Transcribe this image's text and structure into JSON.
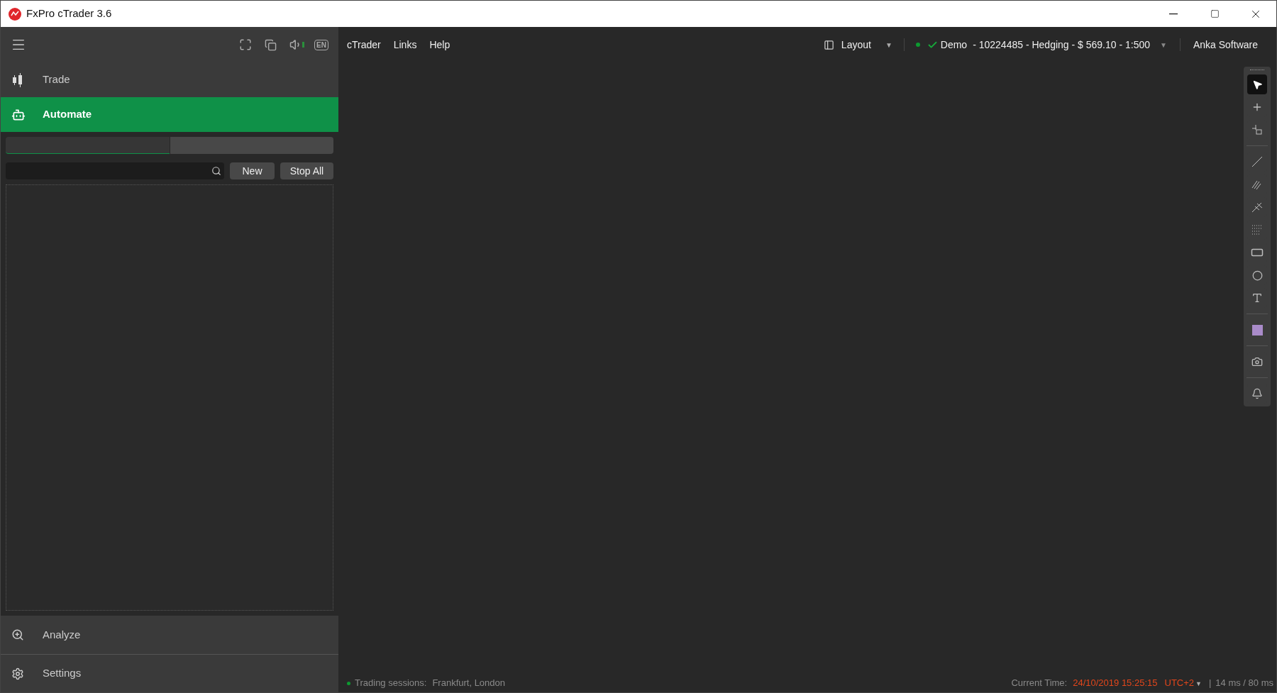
{
  "window": {
    "title": "FxPro cTrader 3.6"
  },
  "sidebar": {
    "header_badge": "EN",
    "sound_on": true,
    "nav": [
      {
        "kind": "trade",
        "label": "Trade",
        "selected": false
      },
      {
        "kind": "automate",
        "label": "Automate",
        "selected": true
      }
    ],
    "tabs": [
      {
        "selected": true
      },
      {
        "selected": false
      }
    ],
    "buttons": [
      "New",
      "Stop All"
    ],
    "bottom_nav": [
      {
        "kind": "analyze",
        "label": "Analyze"
      },
      {
        "kind": "settings",
        "label": "Settings"
      }
    ]
  },
  "menu": [
    "cTrader",
    "Links",
    "Help"
  ],
  "layout": {
    "label": "Layout",
    "caret": "▼"
  },
  "account": {
    "connected": true,
    "mode": "Demo",
    "details": "- 10224485 - Hedging - $ 569.10 - 1:500",
    "caret": "▼"
  },
  "user": "Anka Software",
  "tools": [
    {
      "kind": "pointer",
      "selected": true
    },
    {
      "kind": "crosshair",
      "selected": false
    },
    {
      "kind": "zoom",
      "selected": false
    },
    {
      "kind": "separator"
    },
    {
      "kind": "line",
      "selected": false
    },
    {
      "kind": "elliott",
      "selected": false
    },
    {
      "kind": "pitchfork",
      "selected": false
    },
    {
      "kind": "fibonacci",
      "selected": false
    },
    {
      "kind": "rectangle",
      "selected": false
    },
    {
      "kind": "ellipse",
      "selected": false
    },
    {
      "kind": "text",
      "selected": false
    },
    {
      "kind": "separator"
    },
    {
      "kind": "color",
      "selected": false,
      "color": "#a98bc9"
    },
    {
      "kind": "separator"
    },
    {
      "kind": "camera",
      "selected": false
    },
    {
      "kind": "separator"
    },
    {
      "kind": "alert",
      "selected": false
    }
  ],
  "status_bar": {
    "sessions_label": "Trading sessions:",
    "sessions": "Frankfurt, London",
    "sessions_open": true,
    "time_label": "Current Time:",
    "time": "24/10/2019 15:25:15",
    "timezone": "UTC+2",
    "timezone_caret": "▼",
    "divider": "|",
    "latency": "14 ms / 80 ms"
  }
}
